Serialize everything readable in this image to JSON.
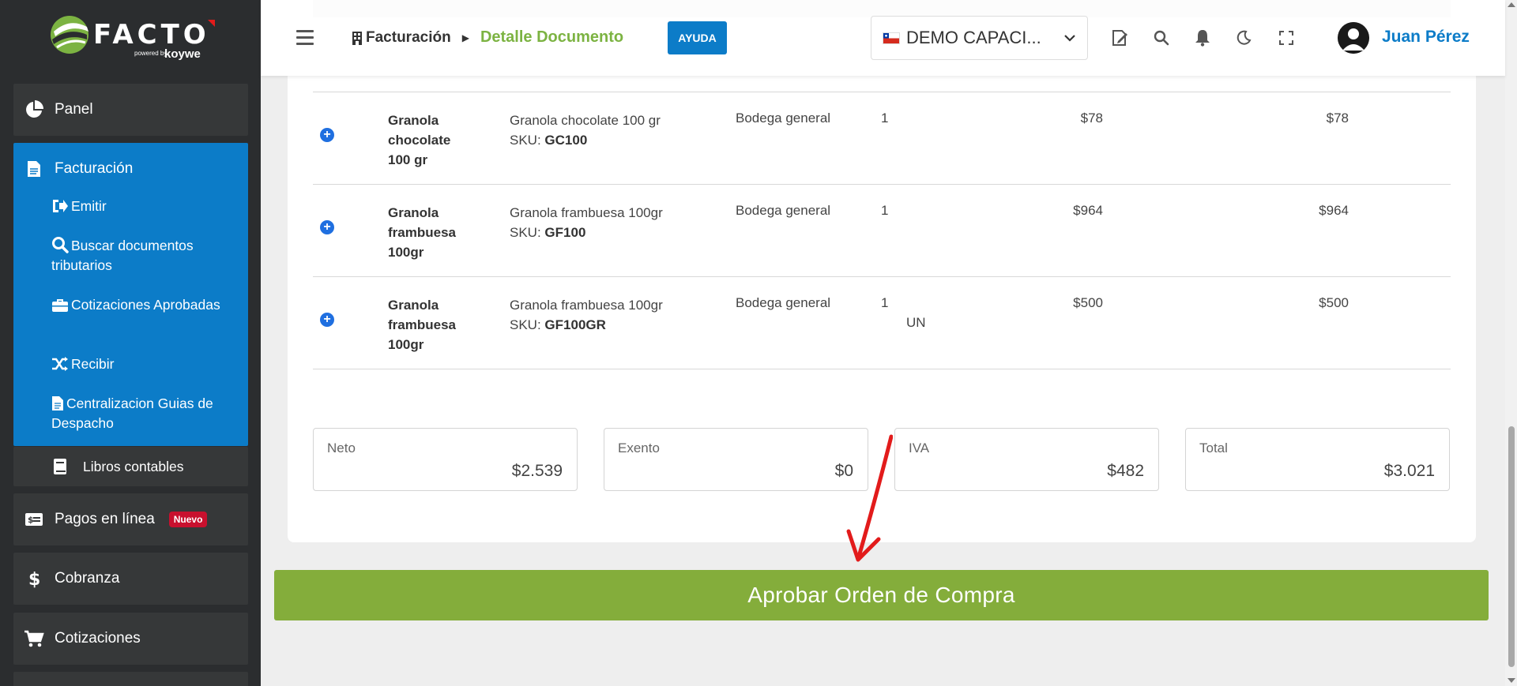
{
  "brand": {
    "name": "FACTO",
    "powered": "powered by",
    "partner": "koywe"
  },
  "sidebar": {
    "panel": "Panel",
    "facturacion": "Facturación",
    "sub_items": [
      "Emitir",
      "Buscar documentos tributarios",
      "Cotizaciones Aprobadas",
      "Recibir",
      "Centralizacion Guias de Despacho"
    ],
    "libros": "Libros contables",
    "pagos": "Pagos en línea",
    "pagos_badge": "Nuevo",
    "cobranza": "Cobranza",
    "cotizaciones": "Cotizaciones"
  },
  "header": {
    "breadcrumb_root": "Facturación",
    "breadcrumb_current": "Detalle Documento",
    "help_button": "AYUDA",
    "company": "DEMO CAPACI...",
    "user_name": "Juan Pérez",
    "icons": [
      "edit-document-icon",
      "search-icon",
      "bell-icon",
      "moon-icon",
      "fullscreen-icon"
    ]
  },
  "products": [
    {
      "name": "Granola chocolate 100 gr",
      "desc": "Granola chocolate 100 gr",
      "sku_label": "SKU:",
      "sku": "GC100",
      "bodega": "Bodega general",
      "qty": "1",
      "unit": "",
      "price": "$78",
      "total": "$78"
    },
    {
      "name": "Granola frambuesa 100gr",
      "desc": "Granola frambuesa 100gr",
      "sku_label": "SKU:",
      "sku": "GF100",
      "bodega": "Bodega general",
      "qty": "1",
      "unit": "",
      "price": "$964",
      "total": "$964"
    },
    {
      "name": "Granola frambuesa 100gr",
      "desc": "Granola frambuesa 100gr",
      "sku_label": "SKU:",
      "sku": "GF100GR",
      "bodega": "Bodega general",
      "qty": "1",
      "unit": "UN",
      "price": "$500",
      "total": "$500"
    }
  ],
  "totals": {
    "neto_label": "Neto",
    "neto": "$2.539",
    "exento_label": "Exento",
    "exento": "$0",
    "iva_label": "IVA",
    "iva": "$482",
    "total_label": "Total",
    "total": "$3.021"
  },
  "approve_button": "Aprobar Orden de Compra",
  "colors": {
    "primary": "#0c7cc8",
    "accent_green": "#7cb342",
    "approve": "#84ad3b",
    "sidebar": "#2b2d2f",
    "badge": "#c8102e",
    "arrow": "#e21b1b"
  }
}
